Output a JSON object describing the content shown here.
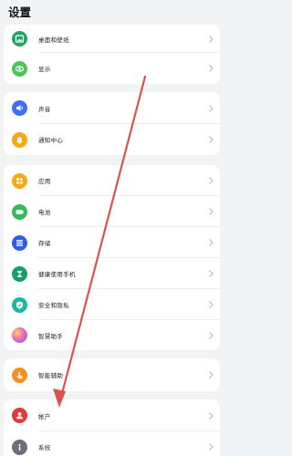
{
  "header": {
    "title": "设置"
  },
  "groups": [
    {
      "items": [
        {
          "id": "wallpaper",
          "label": "桌面和壁纸",
          "icon": "wallpaper-icon",
          "color": "#1fa463"
        },
        {
          "id": "display",
          "label": "显示",
          "icon": "display-icon",
          "color": "#4cc45a"
        }
      ]
    },
    {
      "items": [
        {
          "id": "sound",
          "label": "声音",
          "icon": "sound-icon",
          "color": "#3f6ef6"
        },
        {
          "id": "notification",
          "label": "通知中心",
          "icon": "notification-bell-icon",
          "color": "#f7a814"
        }
      ]
    },
    {
      "items": [
        {
          "id": "apps",
          "label": "应用",
          "icon": "apps-grid-icon",
          "color": "#f7a814"
        },
        {
          "id": "battery",
          "label": "电池",
          "icon": "battery-icon",
          "color": "#35b95c"
        },
        {
          "id": "storage",
          "label": "存储",
          "icon": "storage-icon",
          "color": "#2f5fe8"
        },
        {
          "id": "digital-health",
          "label": "健康使用手机",
          "icon": "hourglass-icon",
          "color": "#1a9e67"
        },
        {
          "id": "security",
          "label": "安全和隐私",
          "icon": "shield-icon",
          "color": "#19b9a2"
        },
        {
          "id": "assistant",
          "label": "智慧助手",
          "icon": "smart-assistant-icon",
          "color": "#e86bd0"
        }
      ]
    },
    {
      "items": [
        {
          "id": "accessibility",
          "label": "智能辅助",
          "icon": "hand-icon",
          "color": "#f2921a"
        }
      ]
    },
    {
      "items": [
        {
          "id": "account",
          "label": "帐户",
          "icon": "account-icon",
          "color": "#e23b3b"
        },
        {
          "id": "system",
          "label": "系统",
          "icon": "info-icon",
          "color": "#6d6f77"
        }
      ]
    }
  ]
}
